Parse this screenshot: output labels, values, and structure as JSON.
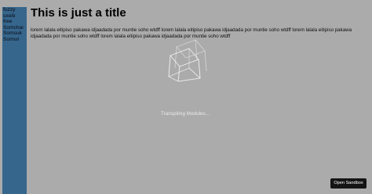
{
  "sidebar": {
    "items": [
      {
        "label": "fuzzy"
      },
      {
        "label": "sxeib"
      },
      {
        "label": "free"
      },
      {
        "label": "Somchai"
      },
      {
        "label": "Somsuk"
      },
      {
        "label": "Somsri"
      }
    ]
  },
  "main": {
    "title": "This is just a title",
    "body": "lorem lalala eitipiso pakawa idjaadada por muntie soho wtdff lorem lalala eitipiso pakawa idjaadada por muntie soho wtdff lorem lalala eitipiso pakawa idjaadada por muntie soho wtdff lorem lalala eitipiso pakawa idjaadada por muntie soho wtdff"
  },
  "loader": {
    "icon": "wireframe-cube-icon",
    "text": "Transpiling Modules..."
  },
  "actions": {
    "open_sandbox_label": "Open Sandbox"
  },
  "colors": {
    "background": "#ababab",
    "sidebar": "#36668c",
    "button": "#151515"
  }
}
